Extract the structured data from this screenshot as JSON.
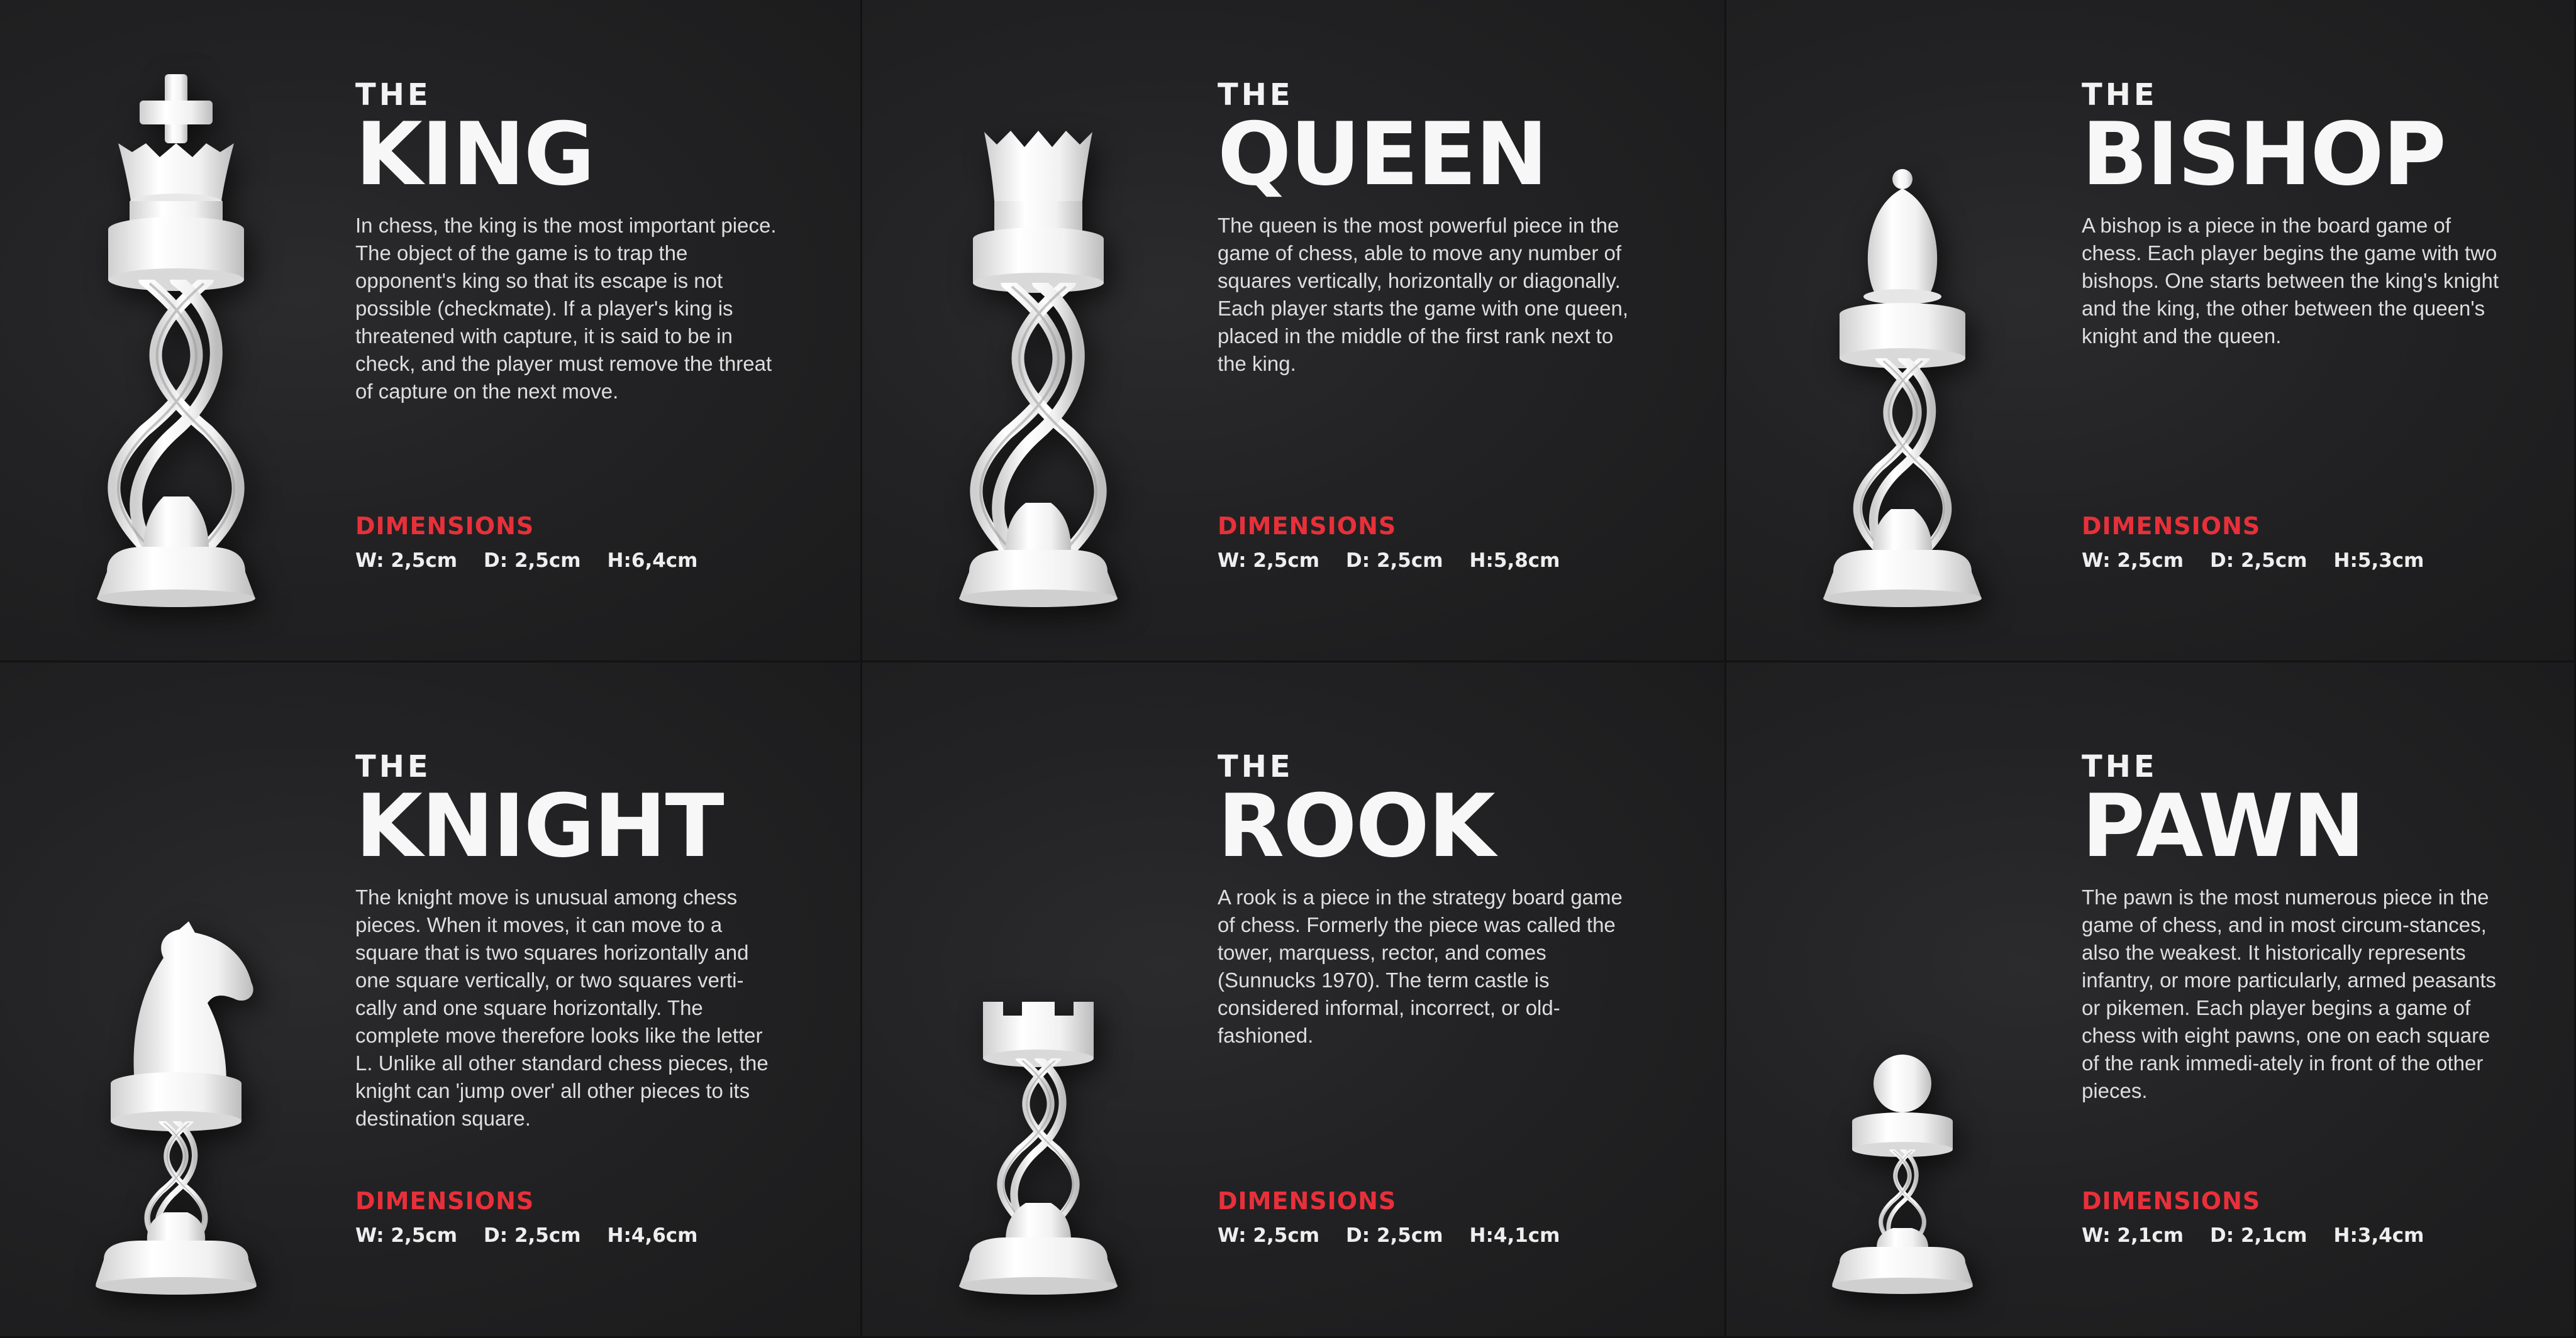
{
  "cards": [
    {
      "the": "THE",
      "name": "KING",
      "description": "In chess, the king is the most important piece. The object of the game is to trap the opponent's king so that its escape is not possible (checkmate). If a player's king is threatened with capture, it is said to be in check, and the player must remove the threat of capture on the next move.",
      "dims_title": "DIMENSIONS",
      "w": "W: 2,5cm",
      "d": "D: 2,5cm",
      "h": "H:6,4cm",
      "icon": "king-piece-icon"
    },
    {
      "the": "THE",
      "name": "QUEEN",
      "description": "The queen is the most powerful piece in the game of chess, able to move any number of squares vertically, horizontally or diagonally. Each player starts the game with one queen, placed in the middle of the first rank next to the king.",
      "dims_title": "DIMENSIONS",
      "w": "W: 2,5cm",
      "d": "D: 2,5cm",
      "h": "H:5,8cm",
      "icon": "queen-piece-icon"
    },
    {
      "the": "THE",
      "name": "BISHOP",
      "description": "A bishop is a piece in the board game of chess. Each player begins the game with two bishops. One starts between the king's knight and the king, the other between the queen's knight and the queen.",
      "dims_title": "DIMENSIONS",
      "w": "W: 2,5cm",
      "d": "D: 2,5cm",
      "h": "H:5,3cm",
      "icon": "bishop-piece-icon"
    },
    {
      "the": "THE",
      "name": "KNIGHT",
      "description": "The knight move is unusual among chess pieces. When it moves, it can move to a square that is two squares horizontally and one square vertically, or two squares verti-cally and one square horizontally. The complete move therefore looks like the letter L. Unlike all other standard chess pieces, the knight can 'jump over' all other pieces to its destination square.",
      "dims_title": "DIMENSIONS",
      "w": "W: 2,5cm",
      "d": "D: 2,5cm",
      "h": "H:4,6cm",
      "icon": "knight-piece-icon"
    },
    {
      "the": "THE",
      "name": "ROOK",
      "description": "A rook is a piece in the strategy board game of chess. Formerly the piece was called the tower, marquess, rector, and comes (Sunnucks 1970). The term castle is considered informal, incorrect, or old-fashioned.",
      "dims_title": "DIMENSIONS",
      "w": "W: 2,5cm",
      "d": "D: 2,5cm",
      "h": "H:4,1cm",
      "icon": "rook-piece-icon"
    },
    {
      "the": "THE",
      "name": "PAWN",
      "description": "The pawn is the most numerous piece in the game of chess, and in most circum-stances, also the weakest. It historically represents infantry, or more particularly, armed peasants or pikemen. Each player begins a game of chess with eight pawns, one on each square of the rank immedi-ately in front of the other pieces.",
      "dims_title": "DIMENSIONS",
      "w": "W: 2,1cm",
      "d": "D: 2,1cm",
      "h": "H:3,4cm",
      "icon": "pawn-piece-icon"
    }
  ]
}
